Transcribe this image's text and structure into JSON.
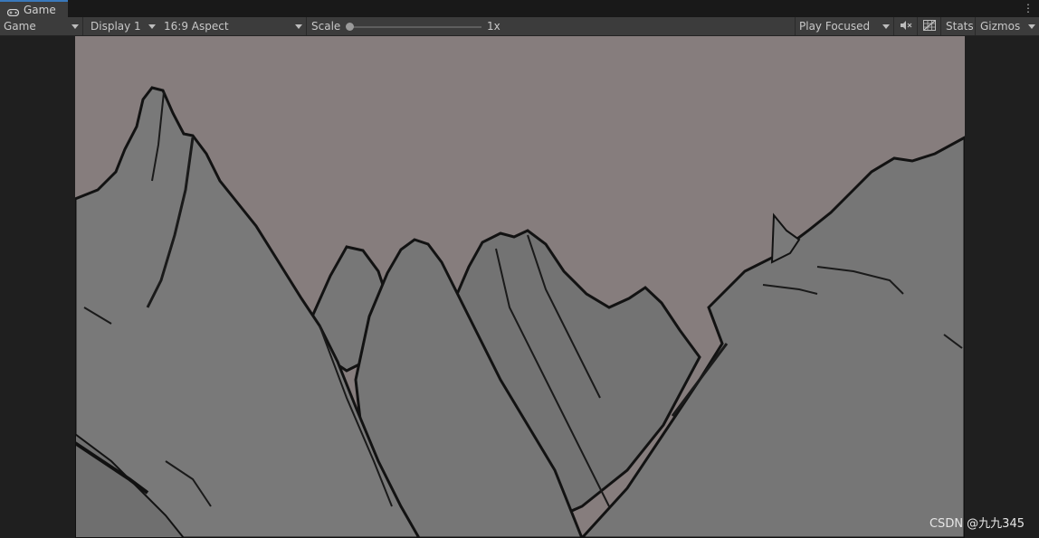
{
  "tab": {
    "title": "Game"
  },
  "toolbar": {
    "view_mode": "Game",
    "display": "Display 1",
    "aspect": "16:9 Aspect",
    "scale_label": "Scale",
    "scale_value": "1x",
    "play_mode": "Play Focused",
    "stats_label": "Stats",
    "gizmos_label": "Gizmos"
  },
  "icons": {
    "tab": "gamepad-icon",
    "menu": "kebab-menu-icon",
    "mute": "mute-audio-icon",
    "grid": "grid-icon"
  },
  "colors": {
    "sky": "#867d7d",
    "mountain": "#777777",
    "mountain_shade": "#6d6d6d",
    "edge": "#121212",
    "tab_accent": "#3a79bb",
    "toolbar_bg": "#3c3c3c"
  },
  "watermark": "CSDN @九九345"
}
